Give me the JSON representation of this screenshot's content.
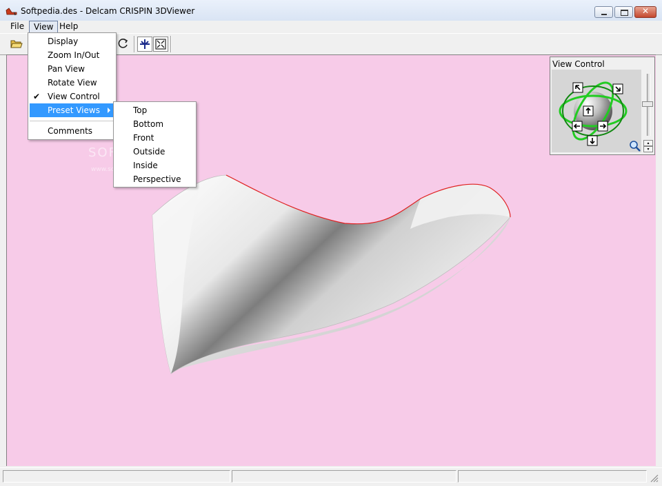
{
  "window": {
    "title": "Softpedia.des - Delcam CRISPIN 3DViewer",
    "close_glyph": "✕"
  },
  "menubar": {
    "items": [
      "File",
      "View",
      "Help"
    ]
  },
  "view_menu": {
    "items": [
      {
        "label": "Display",
        "checked": false
      },
      {
        "label": "Zoom In/Out",
        "checked": false
      },
      {
        "label": "Pan View",
        "checked": false
      },
      {
        "label": "Rotate View",
        "checked": false
      },
      {
        "label": "View Control",
        "checked": true
      },
      {
        "label": "Preset Views",
        "highlighted": true,
        "has_submenu": true
      },
      {
        "label": "Comments",
        "checked": false
      }
    ],
    "check_glyph": "✔"
  },
  "preset_menu": {
    "items": [
      "Top",
      "Bottom",
      "Front",
      "Outside",
      "Inside",
      "Perspective"
    ]
  },
  "view_control": {
    "title": "View Control"
  },
  "watermark": {
    "main": "SOFTPEDIA",
    "sub": "www.softpedia.com"
  },
  "colors": {
    "viewport_bg": "#f7cbe8",
    "menu_highlight": "#3399ff",
    "model_outline": "#e02020",
    "gizmo_ring": "#22cc22"
  },
  "icons": {
    "toolbar": [
      "open-folder-icon",
      "rotate-icon",
      "pan-icon",
      "zoom-fit-icon"
    ]
  }
}
